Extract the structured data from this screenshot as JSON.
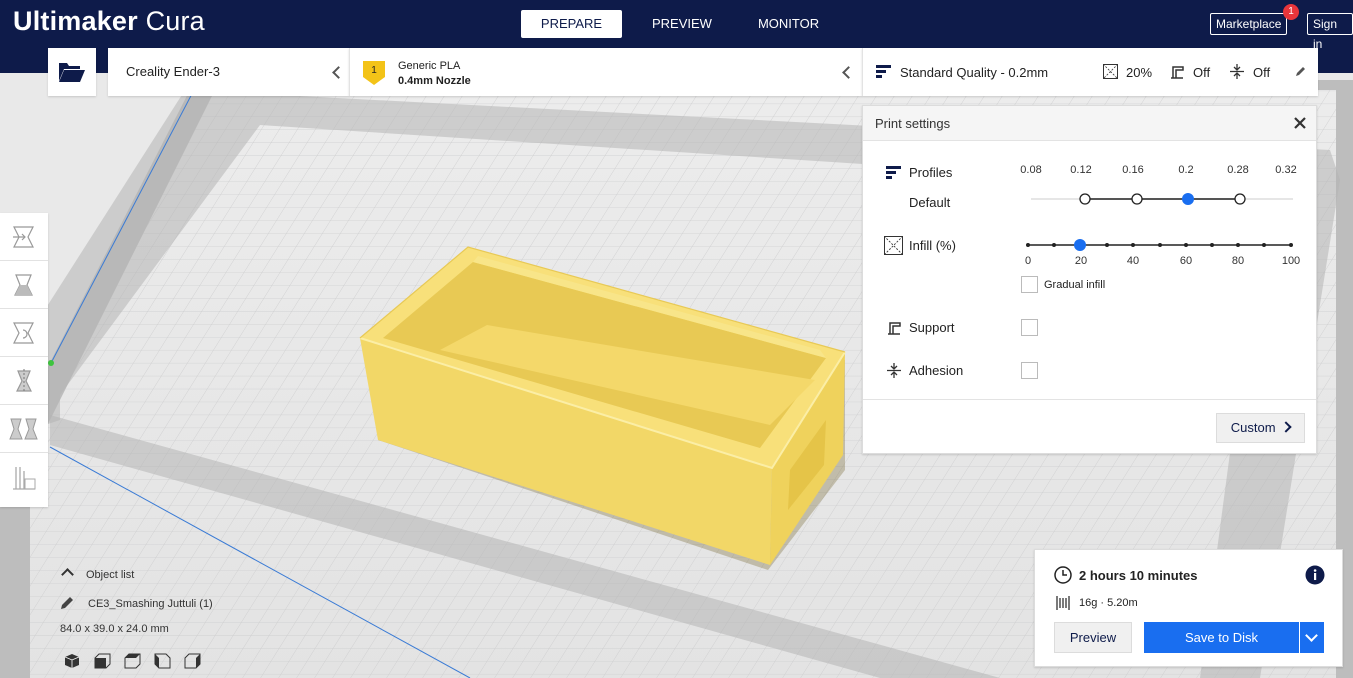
{
  "app": {
    "logo_main": "Ultimaker",
    "logo_sub": "Cura"
  },
  "stages": [
    {
      "label": "PREPARE"
    },
    {
      "label": "PREVIEW"
    },
    {
      "label": "MONITOR"
    }
  ],
  "header": {
    "marketplace_label": "Marketplace",
    "marketplace_badge": "1",
    "signin_label": "Sign in"
  },
  "machine": {
    "printer_name": "Creality Ender-3",
    "extruder_number": "1",
    "material": "Generic PLA",
    "nozzle": "0.4mm Nozzle"
  },
  "print_setup_bar": {
    "profile": "Standard Quality - 0.2mm",
    "infill": "20%",
    "support": "Off",
    "adhesion": "Off"
  },
  "print_settings": {
    "title": "Print settings",
    "profiles_label": "Profiles",
    "profile_default_label": "Default",
    "layer_heights": [
      "0.08",
      "0.12",
      "0.16",
      "0.2",
      "0.28",
      "0.32"
    ],
    "selected_layer_height": "0.2",
    "infill_label": "Infill (%)",
    "infill_ticks": [
      "0",
      "20",
      "40",
      "60",
      "80",
      "100"
    ],
    "infill_value": 20,
    "gradual_infill_label": "Gradual infill",
    "gradual_infill_checked": false,
    "support_label": "Support",
    "support_checked": false,
    "adhesion_label": "Adhesion",
    "adhesion_checked": false,
    "custom_button": "Custom"
  },
  "object_list": {
    "header": "Object list",
    "object_name": "CE3_Smashing Juttuli (1)",
    "dimensions": "84.0 x 39.0 x 24.0 mm"
  },
  "print_info": {
    "time": "2 hours 10 minutes",
    "material_usage": "16g · 5.20m",
    "preview_button": "Preview",
    "save_button": "Save to Disk"
  },
  "colors": {
    "header_bg": "#0e1b4a",
    "accent_blue": "#196ef0",
    "model_yellow": "#f6dd72",
    "badge_red": "#e8353b"
  }
}
